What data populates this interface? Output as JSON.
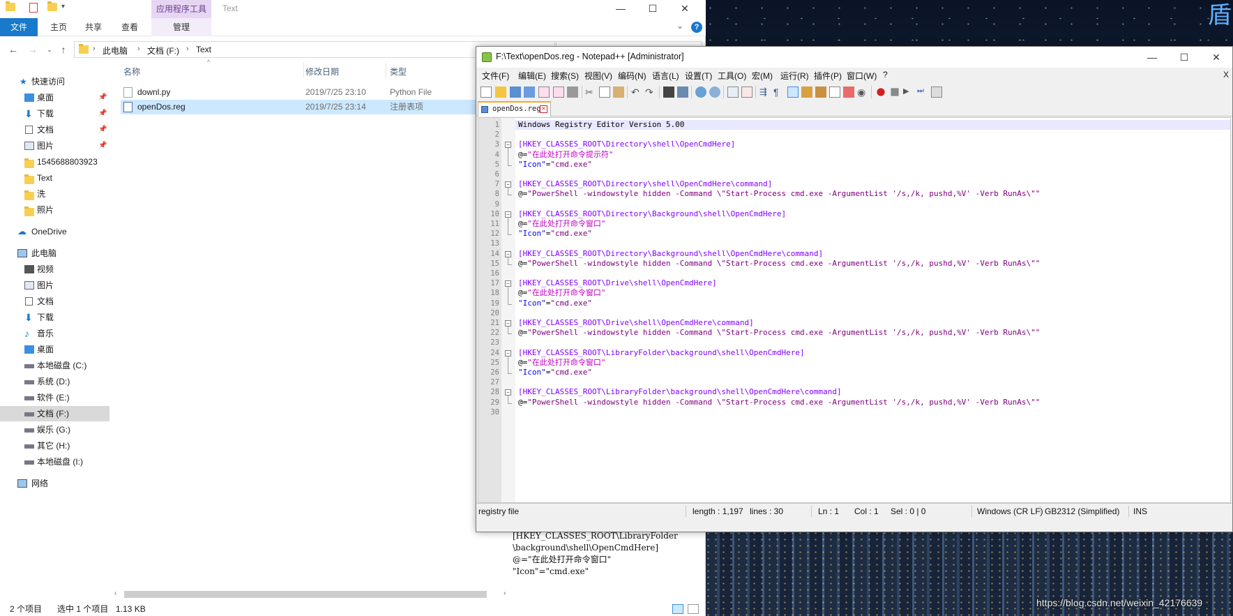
{
  "explorer": {
    "context_tab_header": "应用程序工具",
    "title": "Text",
    "ribbon_tabs": [
      "文件",
      "主页",
      "共享",
      "查看",
      "管理"
    ],
    "breadcrumb": [
      "此电脑",
      "文档 (F:)",
      "Text"
    ],
    "nav": {
      "quick_access": "快速访问",
      "pinned": [
        "桌面",
        "下载",
        "文档",
        "图片"
      ],
      "folders": [
        "1545688803923",
        "Text",
        "洗",
        "照片"
      ],
      "onedrive": "OneDrive",
      "this_pc": "此电脑",
      "pc_items": [
        "视频",
        "图片",
        "文档",
        "下载",
        "音乐",
        "桌面"
      ],
      "drives": [
        "本地磁盘 (C:)",
        "系统 (D:)",
        "软件 (E:)",
        "文档 (F:)",
        "娱乐 (G:)",
        "其它 (H:)",
        "本地磁盘 (I:)"
      ],
      "network": "网络"
    },
    "columns": {
      "name": "名称",
      "modified": "修改日期",
      "type": "类型"
    },
    "files": [
      {
        "name": "downl.py",
        "modified": "2019/7/25 23:10",
        "type": "Python File"
      },
      {
        "name": "openDos.reg",
        "modified": "2019/7/25 23:14",
        "type": "注册表项"
      }
    ],
    "preview_text": "[HKEY_CLASSES_ROOT\\LibraryFolder\n\\background\\shell\\OpenCmdHere]\n@=\"在此处打开命令窗口\"\n\"Icon\"=\"cmd.exe\"",
    "status": {
      "count": "2 个项目",
      "selected": "选中 1 个项目",
      "size": "1.13 KB"
    }
  },
  "npp": {
    "title": "F:\\Text\\openDos.reg - Notepad++ [Administrator]",
    "menus": [
      "文件(F)",
      "编辑(E)",
      "搜索(S)",
      "视图(V)",
      "编码(N)",
      "语言(L)",
      "设置(T)",
      "工具(O)",
      "宏(M)",
      "运行(R)",
      "插件(P)",
      "窗口(W)",
      "?"
    ],
    "close_doc": "X",
    "tab_label": "openDos.reg",
    "lines": [
      "Windows Registry Editor Version 5.00",
      "",
      "[HKEY_CLASSES_ROOT\\Directory\\shell\\OpenCmdHere]",
      "@=\"在此处打开命令提示符\"",
      "\"Icon\"=\"cmd.exe\"",
      "",
      "[HKEY_CLASSES_ROOT\\Directory\\shell\\OpenCmdHere\\command]",
      "@=\"PowerShell -windowstyle hidden -Command \\\"Start-Process cmd.exe -ArgumentList '/s,/k, pushd,%V' -Verb RunAs\\\"\"",
      "",
      "[HKEY_CLASSES_ROOT\\Directory\\Background\\shell\\OpenCmdHere]",
      "@=\"在此处打开命令窗口\"",
      "\"Icon\"=\"cmd.exe\"",
      "",
      "[HKEY_CLASSES_ROOT\\Directory\\Background\\shell\\OpenCmdHere\\command]",
      "@=\"PowerShell -windowstyle hidden -Command \\\"Start-Process cmd.exe -ArgumentList '/s,/k, pushd,%V' -Verb RunAs\\\"\"",
      "",
      "[HKEY_CLASSES_ROOT\\Drive\\shell\\OpenCmdHere]",
      "@=\"在此处打开命令窗口\"",
      "\"Icon\"=\"cmd.exe\"",
      "",
      "[HKEY_CLASSES_ROOT\\Drive\\shell\\OpenCmdHere\\command]",
      "@=\"PowerShell -windowstyle hidden -Command \\\"Start-Process cmd.exe -ArgumentList '/s,/k, pushd,%V' -Verb RunAs\\\"\"",
      "",
      "[HKEY_CLASSES_ROOT\\LibraryFolder\\background\\shell\\OpenCmdHere]",
      "@=\"在此处打开命令窗口\"",
      "\"Icon\"=\"cmd.exe\"",
      "",
      "[HKEY_CLASSES_ROOT\\LibraryFolder\\background\\shell\\OpenCmdHere\\command]",
      "@=\"PowerShell -windowstyle hidden -Command \\\"Start-Process cmd.exe -ArgumentList '/s,/k, pushd,%V' -Verb RunAs\\\"\"",
      ""
    ],
    "status": {
      "lang": "registry file",
      "length": "length : 1,197",
      "lines": "lines : 30",
      "ln": "Ln : 1",
      "col": "Col : 1",
      "sel": "Sel : 0 | 0",
      "eol": "Windows (CR LF)",
      "encoding": "GB2312 (Simplified)",
      "mode": "INS"
    }
  },
  "colors": {
    "accent": "#1979ca",
    "section_purple": "#8000ff",
    "string_purple": "#800080",
    "key_blue": "#0000ff",
    "cjk_magenta": "#c000c0"
  },
  "watermark": "https://blog.csdn.net/weixin_42176639"
}
